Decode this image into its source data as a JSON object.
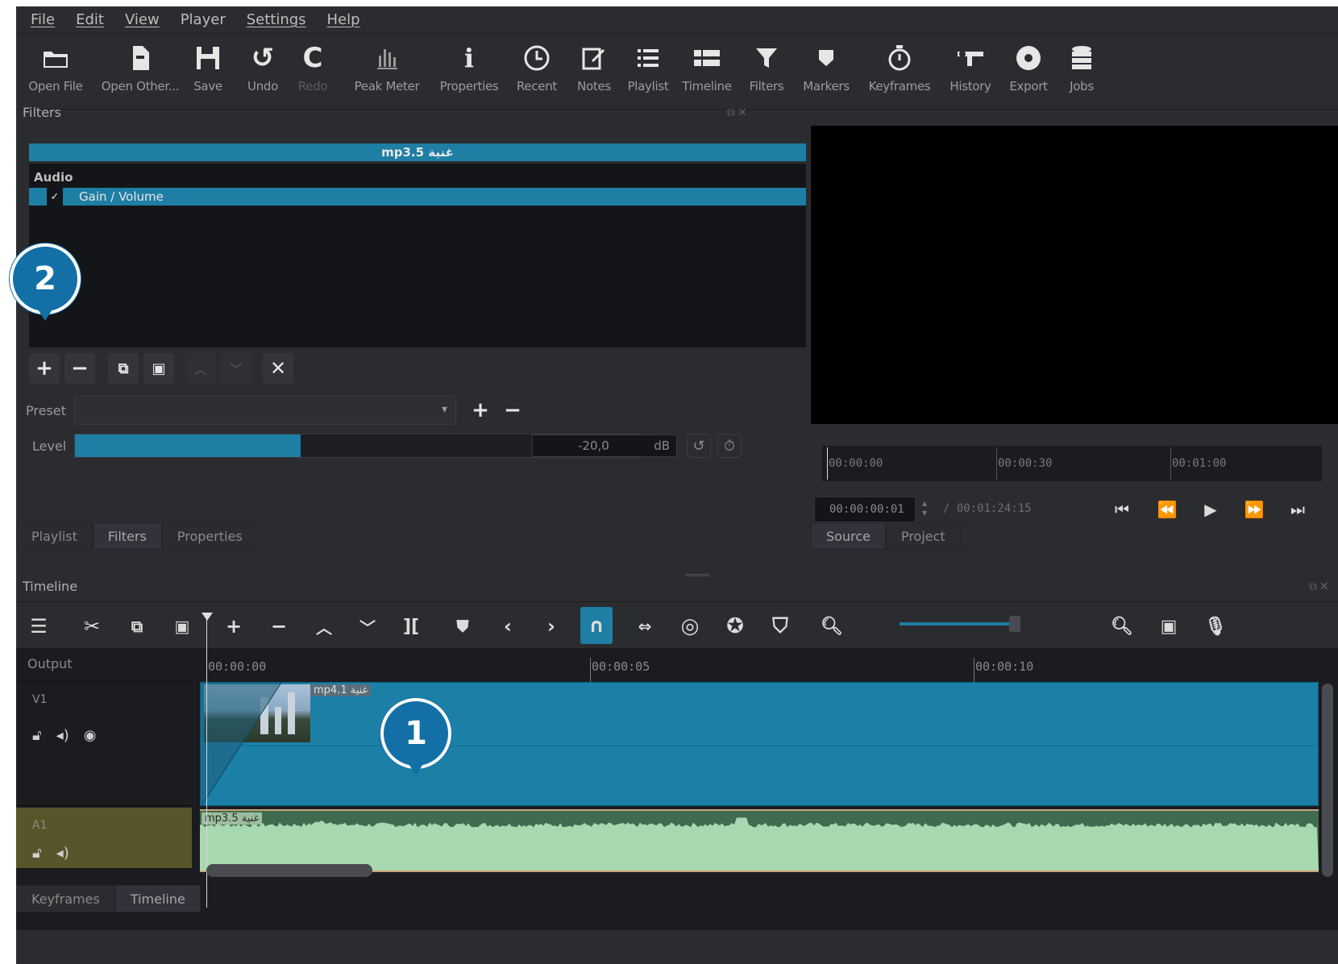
{
  "menu": [
    "File",
    "Edit",
    "View",
    "Player",
    "Settings",
    "Help"
  ],
  "toolbar": [
    {
      "label": "Open File",
      "icon": "folder-open-icon"
    },
    {
      "label": "Open Other...",
      "icon": "open-other-icon"
    },
    {
      "label": "Save",
      "icon": "save-icon"
    },
    {
      "label": "Undo",
      "icon": "undo-icon"
    },
    {
      "label": "Redo",
      "icon": "redo-icon"
    },
    {
      "label": "Peak Meter",
      "icon": "peak-meter-icon"
    },
    {
      "label": "Properties",
      "icon": "info-icon"
    },
    {
      "label": "Recent",
      "icon": "clock-icon"
    },
    {
      "label": "Notes",
      "icon": "notes-icon"
    },
    {
      "label": "Playlist",
      "icon": "playlist-icon"
    },
    {
      "label": "Timeline",
      "icon": "timeline-icon"
    },
    {
      "label": "Filters",
      "icon": "funnel-icon"
    },
    {
      "label": "Markers",
      "icon": "marker-icon"
    },
    {
      "label": "Keyframes",
      "icon": "stopwatch-icon"
    },
    {
      "label": "History",
      "icon": "history-icon"
    },
    {
      "label": "Export",
      "icon": "export-icon"
    },
    {
      "label": "Jobs",
      "icon": "jobs-icon"
    }
  ],
  "filters": {
    "panel_title": "Filters",
    "clip_name": "mp3.5 غنية",
    "category": "Audio",
    "items": [
      {
        "name": "Gain / Volume",
        "checked": "✓"
      }
    ],
    "preset_label": "Preset",
    "level_label": "Level",
    "level_value": "-20,0",
    "level_unit": "dB",
    "level_fraction": 0.4
  },
  "left_tabs": [
    "Playlist",
    "Filters",
    "Properties"
  ],
  "player": {
    "ruler": [
      "00:00:00",
      "00:00:30",
      "00:01:00"
    ],
    "position": "00:00:00:01",
    "duration": "/ 00:01:24:15",
    "tabs": [
      "Source",
      "Project"
    ]
  },
  "timeline": {
    "title": "Timeline",
    "output_label": "Output",
    "ruler": [
      "00:00:00",
      "00:00:05",
      "00:00:10"
    ],
    "tracks": [
      {
        "name": "V1",
        "clip": "mp4.1 غنية"
      },
      {
        "name": "A1",
        "clip": "mp3.5 غنية"
      }
    ],
    "bottom_tabs": [
      "Keyframes",
      "Timeline"
    ]
  },
  "callouts": [
    "1",
    "2"
  ],
  "colors": {
    "accent": "#1e7ea3",
    "callout": "#1370a6",
    "audio_track": "#57562a",
    "waveform": "#a8d8b0"
  }
}
